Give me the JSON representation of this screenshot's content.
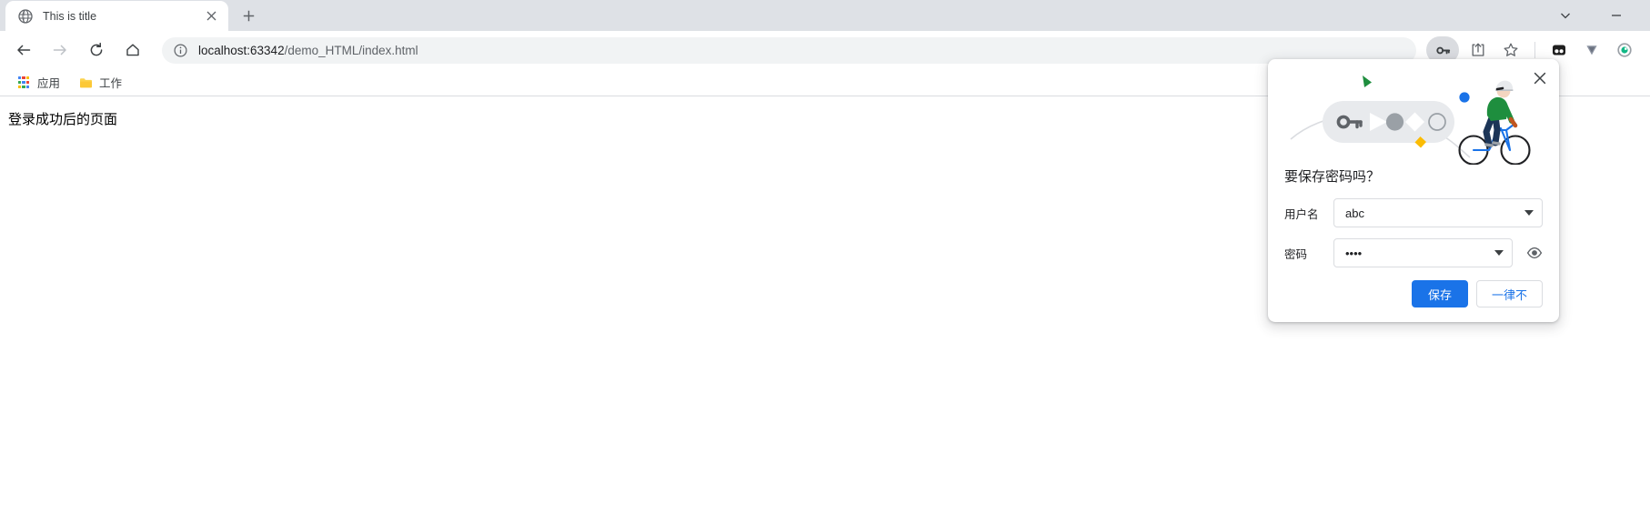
{
  "window": {
    "controls": [
      {
        "name": "chevron-down",
        "label": ""
      },
      {
        "name": "minimize",
        "label": ""
      }
    ]
  },
  "tabs": [
    {
      "title": "This is title",
      "favicon": "globe-icon",
      "close_label": "×",
      "active": true
    }
  ],
  "newtab": {
    "label": "+"
  },
  "toolbar": {
    "back_label": "",
    "forward_label": "",
    "reload_label": "",
    "home_label": "",
    "omnibox": {
      "info_icon": "info-circle-icon",
      "host": "localhost:63342",
      "path": "/demo_HTML/index.html",
      "full_url": "localhost:63342/demo_HTML/index.html"
    },
    "icons": [
      {
        "name": "password-key-icon",
        "active": true
      },
      {
        "name": "share-icon",
        "active": false
      },
      {
        "name": "bookmark-star-icon",
        "active": false
      },
      {
        "name": "extension-dots-icon",
        "active": false
      },
      {
        "name": "extension-v-icon",
        "active": false
      },
      {
        "name": "extension-circle-icon",
        "active": false
      }
    ]
  },
  "bookmarks": [
    {
      "label": "应用",
      "icon": "apps-grid-icon"
    },
    {
      "label": "工作",
      "icon": "folder-icon"
    }
  ],
  "page": {
    "text": "登录成功后的页面"
  },
  "bubble": {
    "close_label": "✕",
    "title": "要保存密码吗？",
    "username": {
      "label": "用户名",
      "value": "abc"
    },
    "password": {
      "label": "密码",
      "value": "••••",
      "reveal_icon": "eye-icon"
    },
    "save_label": "保存",
    "never_label": "一律不",
    "illustration": {
      "name": "password-bike-illustration",
      "elements": [
        "key-icon",
        "triangle-shape",
        "circle-shape",
        "diamond-shape",
        "ring-shape",
        "cyclist",
        "green-triangle",
        "blue-dot",
        "yellow-diamond"
      ]
    }
  },
  "colors": {
    "accent": "#1a73e8",
    "tabstrip_bg": "#dee1e6",
    "omnibox_bg": "#f1f3f4",
    "green": "#1e8e3e",
    "yellow": "#fbbc04",
    "blue_dot": "#1a73e8",
    "gray_shape": "#9aa0a6"
  }
}
